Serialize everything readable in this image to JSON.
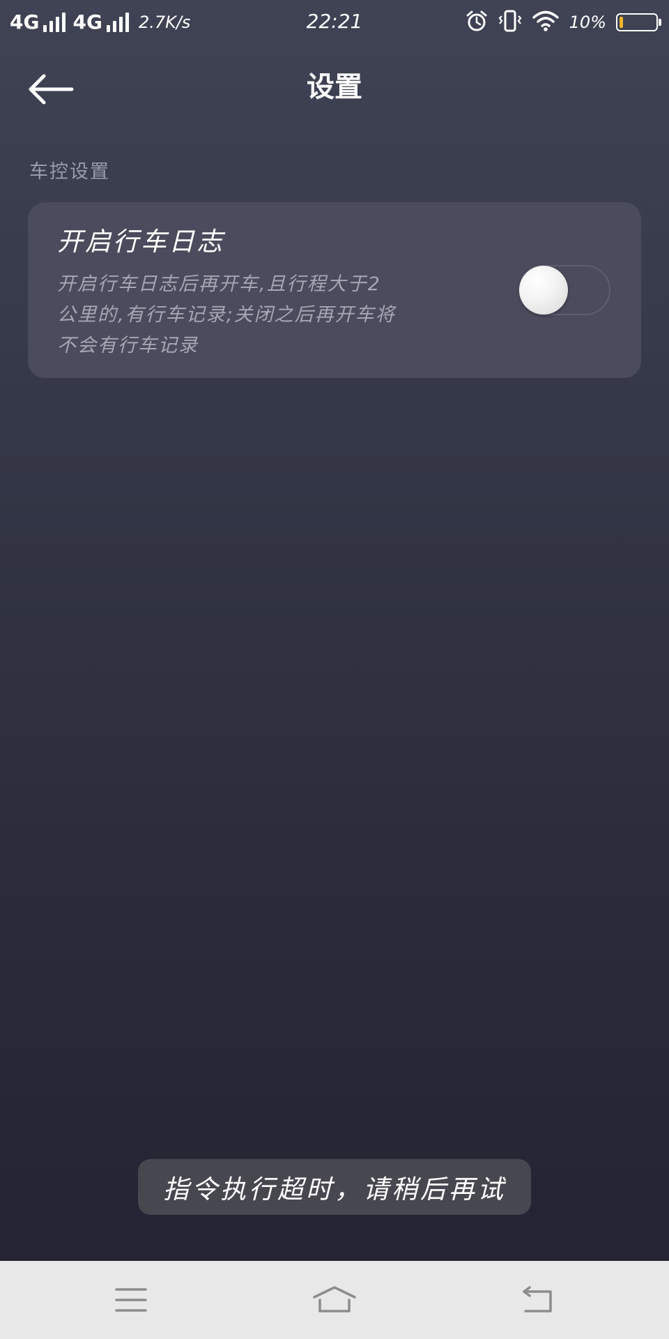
{
  "status_bar": {
    "network1": "4G",
    "network2": "4G",
    "speed": "2.7K/s",
    "time": "22:21",
    "battery_percent_text": "10%",
    "battery_level": 0.1,
    "battery_color": "#f5b72a",
    "icons": [
      "alarm-icon",
      "vibrate-icon",
      "wifi-icon",
      "battery-icon"
    ]
  },
  "header": {
    "title": "设置",
    "back_icon": "back-arrow-icon"
  },
  "section": {
    "label": "车控设置"
  },
  "setting": {
    "title": "开启行车日志",
    "description_lines": [
      "开启行车日志后再开车,且行程大于2",
      "公里的,有行车记录;关闭之后再开车将",
      "不会有行车记录"
    ],
    "enabled": false
  },
  "toast": {
    "text": "指令执行超时，请稍后再试"
  },
  "nav_bar": {
    "icons": [
      "menu-icon",
      "home-icon",
      "return-icon"
    ]
  }
}
